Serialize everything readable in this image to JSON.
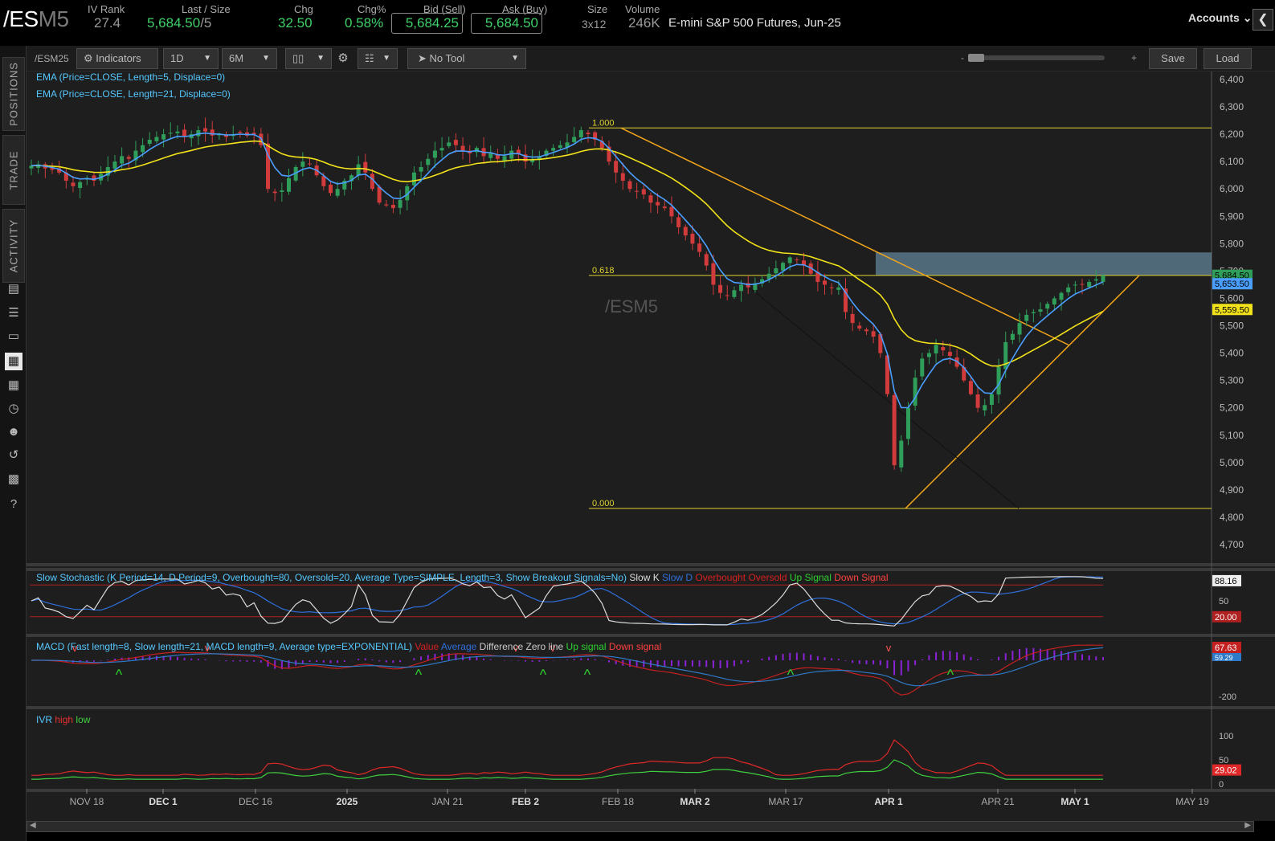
{
  "quote": {
    "symbol_main": "/ES",
    "symbol_suffix": "M5",
    "iv_rank_label": "IV Rank",
    "iv_rank": "27.4",
    "last_size_label": "Last / Size",
    "last": "5,684.50",
    "size": "/5",
    "chg_label": "Chg",
    "chg": "32.50",
    "chg_pct_label": "Chg%",
    "chg_pct": "0.58%",
    "bid_label": "Bid (Sell)",
    "bid": "5,684.25",
    "ask_label": "Ask (Buy)",
    "ask": "5,684.50",
    "size_label": "Size",
    "size_val": "3x12",
    "volume_label": "Volume",
    "volume": "246K",
    "description": "E-mini S&P 500 Futures, Jun-25",
    "accounts_label": "Accounts"
  },
  "left_tabs": [
    "POSITIONS",
    "TRADE",
    "ACTIVITY"
  ],
  "toolbar": {
    "symbol": "/ESM25",
    "indicators": "Indicators",
    "interval": "1D",
    "range": "6M",
    "tool": "No Tool",
    "zoom_minus": "-",
    "zoom_plus": "+",
    "save": "Save",
    "load": "Load"
  },
  "studies": {
    "ema5": "EMA (Price=CLOSE, Length=5, Displace=0)",
    "ema21": "EMA (Price=CLOSE, Length=21, Displace=0)",
    "stoch_title": "Slow Stochastic (K Period=14, D Period=9, Overbought=80, Oversold=20, Average Type=SIMPLE, Length=3, Show Breakout Signals=No)",
    "stoch_legend": [
      "Slow K",
      "Slow D",
      "Overbought",
      "Oversold",
      "Up Signal",
      "Down Signal"
    ],
    "macd_title": "MACD (Fast length=8, Slow length=21, MACD length=9, Average type=EXPONENTIAL)",
    "macd_legend": [
      "Value",
      "Average",
      "Difference",
      "Zero line",
      "Up signal",
      "Down signal"
    ],
    "ivr_title": "IVR",
    "ivr_legend": [
      "high",
      "low"
    ]
  },
  "colors": {
    "up": "#2f9e5a",
    "down": "#d13b3b",
    "ema5": "#4a9eff",
    "ema21": "#f2e21a",
    "fib": "#e0d430",
    "trend": "#f2a51a",
    "zone": "#8fc6e8"
  },
  "chart_data": [
    {
      "type": "candlestick",
      "watermark": "/ESM5",
      "x_labels": [
        "NOV 18",
        "DEC 1",
        "DEC 16",
        "2025",
        "JAN 21",
        "FEB 2",
        "FEB 18",
        "MAR 2",
        "MAR 17",
        "APR 1",
        "APR 21",
        "MAY 1",
        "MAY 19"
      ],
      "y_ticks": [
        6400,
        6300,
        6200,
        6100,
        6000,
        5900,
        5800,
        5700,
        5600,
        5500,
        5400,
        5300,
        5200,
        5100,
        5000,
        4900,
        4800,
        4700
      ],
      "y_tick_labels": [
        "6,400",
        "6,300",
        "6,200",
        "6,100",
        "6,000",
        "5,900",
        "5,800",
        "5,700",
        "5,600",
        "5,500",
        "5,400",
        "5,300",
        "5,200",
        "5,100",
        "5,000",
        "4,900",
        "4,800",
        "4,700"
      ],
      "ylim": [
        4650,
        6430
      ],
      "fib_levels": [
        {
          "label": "1.000",
          "value": 6223
        },
        {
          "label": "0.618",
          "value": 5684
        },
        {
          "label": "0.000",
          "value": 4832
        }
      ],
      "price_tags": [
        {
          "label": "5,684.50",
          "value": 5684.5,
          "color": "#2f9e5a"
        },
        {
          "label": "5,653.50",
          "value": 5653.5,
          "color": "#4a9eff"
        },
        {
          "label": "5,559.50",
          "value": 5559.5,
          "color": "#f2e21a"
        }
      ],
      "resistance_zone": [
        5684,
        5768
      ],
      "closes": [
        6085,
        6090,
        6075,
        6070,
        6060,
        6030,
        6010,
        6025,
        6040,
        6030,
        6055,
        6080,
        6100,
        6120,
        6110,
        6140,
        6160,
        6180,
        6190,
        6200,
        6205,
        6210,
        6190,
        6200,
        6215,
        6210,
        6195,
        6200,
        6190,
        6200,
        6205,
        6195,
        6200,
        6160,
        6000,
        5985,
        5995,
        6040,
        6080,
        6100,
        6090,
        6050,
        6010,
        5985,
        6000,
        6030,
        6050,
        6090,
        6060,
        6000,
        5950,
        5940,
        5930,
        5960,
        6010,
        6060,
        6080,
        6110,
        6140,
        6150,
        6170,
        6160,
        6140,
        6130,
        6150,
        6120,
        6130,
        6110,
        6120,
        6140,
        6130,
        6100,
        6110,
        6120,
        6140,
        6150,
        6160,
        6170,
        6190,
        6215,
        6200,
        6180,
        6150,
        6100,
        6060,
        6030,
        6000,
        5990,
        5980,
        5950,
        5940,
        5930,
        5900,
        5860,
        5830,
        5800,
        5770,
        5720,
        5650,
        5620,
        5610,
        5630,
        5650,
        5640,
        5655,
        5670,
        5690,
        5710,
        5730,
        5750,
        5740,
        5720,
        5690,
        5660,
        5650,
        5640,
        5640,
        5550,
        5510,
        5490,
        5480,
        5460,
        5400,
        5250,
        4990,
        5080,
        5200,
        5310,
        5380,
        5400,
        5430,
        5410,
        5390,
        5350,
        5300,
        5250,
        5200,
        5210,
        5250,
        5350,
        5440,
        5470,
        5510,
        5540,
        5550,
        5560,
        5580,
        5600,
        5620,
        5640,
        5650,
        5650,
        5660,
        5670,
        5684
      ]
    },
    {
      "type": "line",
      "title": "Slow Stochastic",
      "y_tick_labels": [
        "88.16",
        "50",
        "20.00"
      ],
      "ylim": [
        0,
        100
      ],
      "levels": [
        80,
        20
      ]
    },
    {
      "type": "bar+line",
      "title": "MACD",
      "y_tick_labels": [
        "67.63",
        "59.29",
        "-200"
      ]
    },
    {
      "type": "line",
      "title": "IVR",
      "y_tick_labels": [
        "100",
        "50",
        "29.02",
        "0"
      ],
      "ylim": [
        0,
        160
      ]
    }
  ]
}
